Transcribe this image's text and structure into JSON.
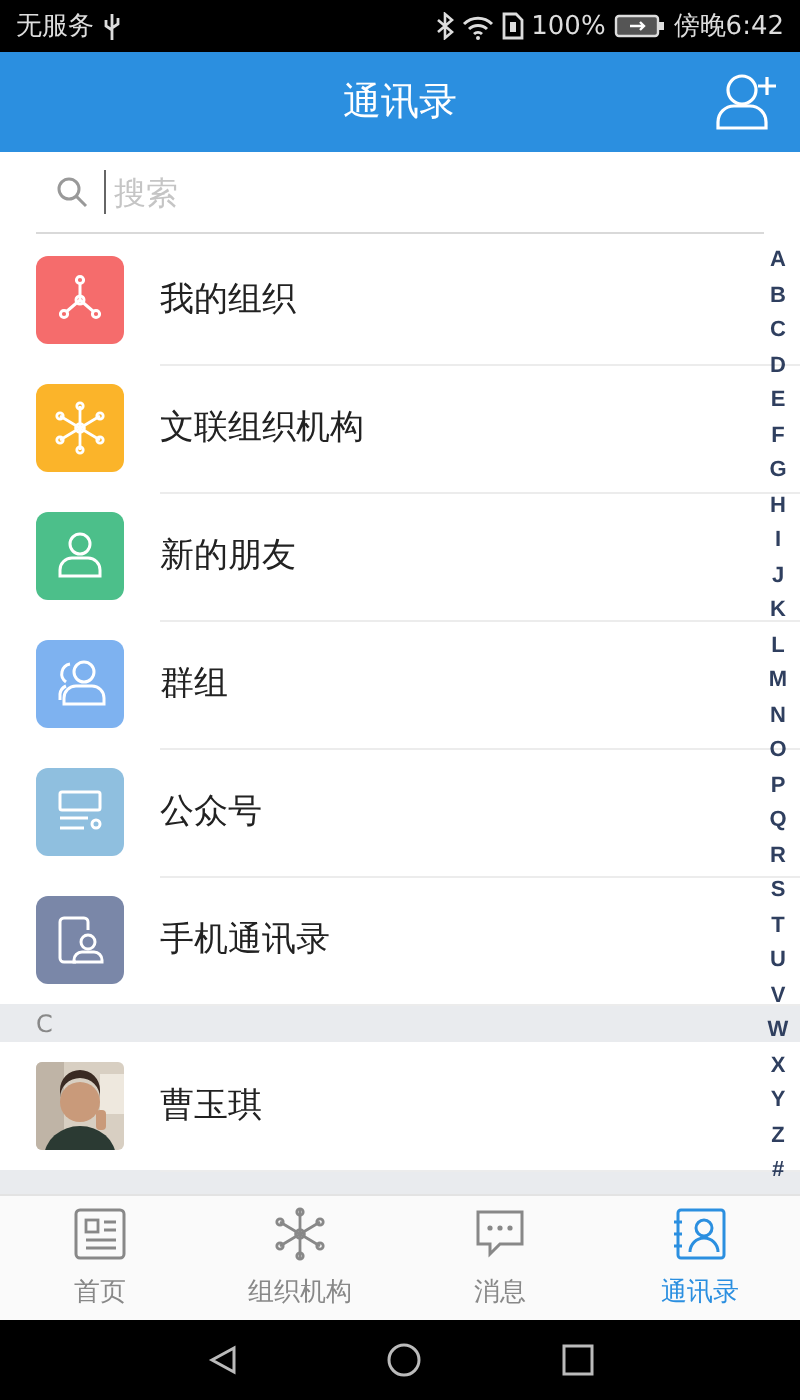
{
  "status_bar": {
    "carrier": "无服务",
    "battery": "100%",
    "time": "傍晚6:42"
  },
  "header": {
    "title": "通讯录"
  },
  "search": {
    "placeholder": "搜索"
  },
  "entries": [
    {
      "kind": "org",
      "label": "我的组织",
      "color": "#f56c6c"
    },
    {
      "kind": "federation",
      "label": "文联组织机构",
      "color": "#fbb42a"
    },
    {
      "kind": "friend",
      "label": "新的朋友",
      "color": "#4cbf8a"
    },
    {
      "kind": "group",
      "label": "群组",
      "color": "#7eb2f0"
    },
    {
      "kind": "official",
      "label": "公众号",
      "color": "#8fbfdf"
    },
    {
      "kind": "phone",
      "label": "手机通讯录",
      "color": "#7a87a8"
    }
  ],
  "sections": [
    {
      "letter": "C",
      "contacts": [
        {
          "name": "曹玉琪"
        }
      ]
    }
  ],
  "index_letters": [
    "A",
    "B",
    "C",
    "D",
    "E",
    "F",
    "G",
    "H",
    "I",
    "J",
    "K",
    "L",
    "M",
    "N",
    "O",
    "P",
    "Q",
    "R",
    "S",
    "T",
    "U",
    "V",
    "W",
    "X",
    "Y",
    "Z",
    "#"
  ],
  "tabs": [
    {
      "kind": "home",
      "label": "首页",
      "selected": false
    },
    {
      "kind": "org",
      "label": "组织机构",
      "selected": false
    },
    {
      "kind": "chat",
      "label": "消息",
      "selected": false
    },
    {
      "kind": "contacts",
      "label": "通讯录",
      "selected": true
    }
  ]
}
